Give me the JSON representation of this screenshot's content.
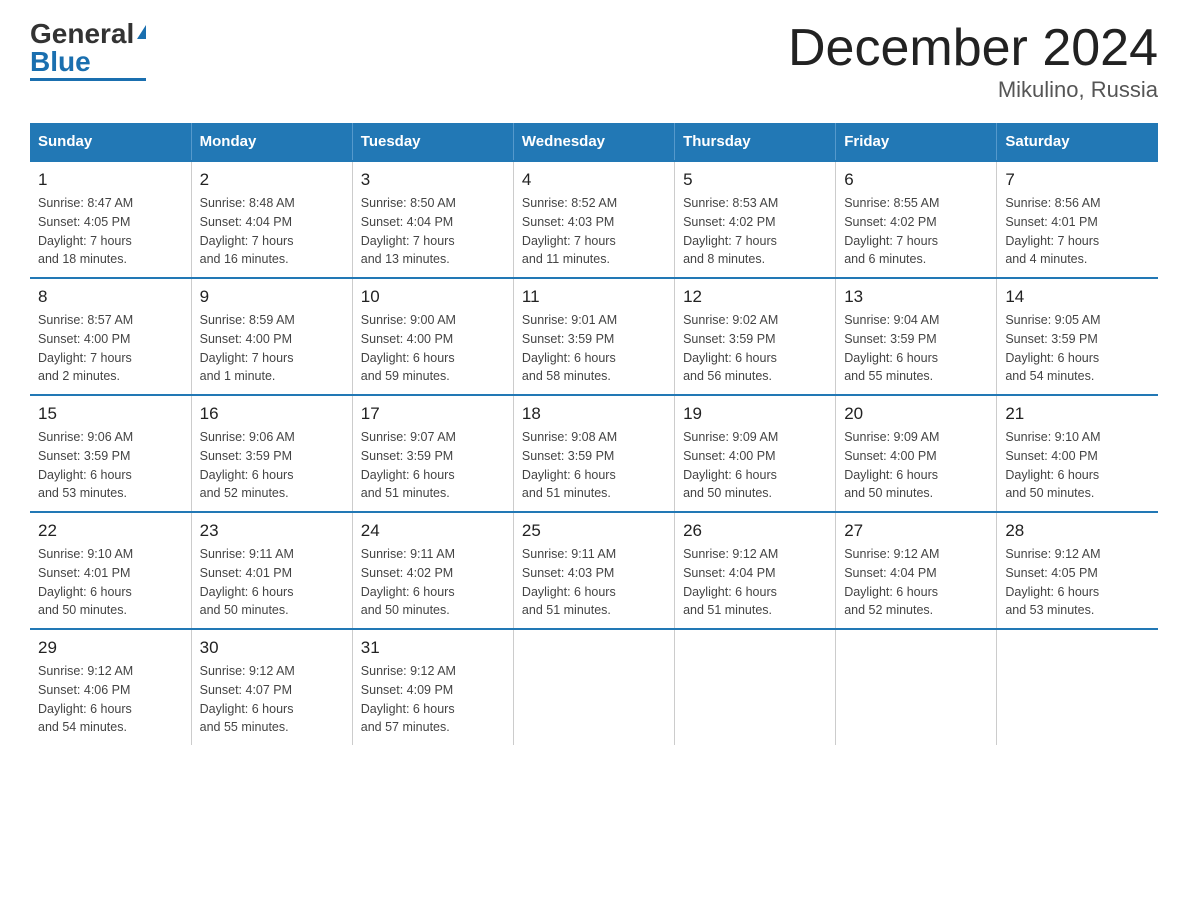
{
  "logo": {
    "general": "General",
    "blue": "Blue"
  },
  "title": "December 2024",
  "location": "Mikulino, Russia",
  "days_of_week": [
    "Sunday",
    "Monday",
    "Tuesday",
    "Wednesday",
    "Thursday",
    "Friday",
    "Saturday"
  ],
  "weeks": [
    [
      {
        "day": "1",
        "info": "Sunrise: 8:47 AM\nSunset: 4:05 PM\nDaylight: 7 hours\nand 18 minutes."
      },
      {
        "day": "2",
        "info": "Sunrise: 8:48 AM\nSunset: 4:04 PM\nDaylight: 7 hours\nand 16 minutes."
      },
      {
        "day": "3",
        "info": "Sunrise: 8:50 AM\nSunset: 4:04 PM\nDaylight: 7 hours\nand 13 minutes."
      },
      {
        "day": "4",
        "info": "Sunrise: 8:52 AM\nSunset: 4:03 PM\nDaylight: 7 hours\nand 11 minutes."
      },
      {
        "day": "5",
        "info": "Sunrise: 8:53 AM\nSunset: 4:02 PM\nDaylight: 7 hours\nand 8 minutes."
      },
      {
        "day": "6",
        "info": "Sunrise: 8:55 AM\nSunset: 4:02 PM\nDaylight: 7 hours\nand 6 minutes."
      },
      {
        "day": "7",
        "info": "Sunrise: 8:56 AM\nSunset: 4:01 PM\nDaylight: 7 hours\nand 4 minutes."
      }
    ],
    [
      {
        "day": "8",
        "info": "Sunrise: 8:57 AM\nSunset: 4:00 PM\nDaylight: 7 hours\nand 2 minutes."
      },
      {
        "day": "9",
        "info": "Sunrise: 8:59 AM\nSunset: 4:00 PM\nDaylight: 7 hours\nand 1 minute."
      },
      {
        "day": "10",
        "info": "Sunrise: 9:00 AM\nSunset: 4:00 PM\nDaylight: 6 hours\nand 59 minutes."
      },
      {
        "day": "11",
        "info": "Sunrise: 9:01 AM\nSunset: 3:59 PM\nDaylight: 6 hours\nand 58 minutes."
      },
      {
        "day": "12",
        "info": "Sunrise: 9:02 AM\nSunset: 3:59 PM\nDaylight: 6 hours\nand 56 minutes."
      },
      {
        "day": "13",
        "info": "Sunrise: 9:04 AM\nSunset: 3:59 PM\nDaylight: 6 hours\nand 55 minutes."
      },
      {
        "day": "14",
        "info": "Sunrise: 9:05 AM\nSunset: 3:59 PM\nDaylight: 6 hours\nand 54 minutes."
      }
    ],
    [
      {
        "day": "15",
        "info": "Sunrise: 9:06 AM\nSunset: 3:59 PM\nDaylight: 6 hours\nand 53 minutes."
      },
      {
        "day": "16",
        "info": "Sunrise: 9:06 AM\nSunset: 3:59 PM\nDaylight: 6 hours\nand 52 minutes."
      },
      {
        "day": "17",
        "info": "Sunrise: 9:07 AM\nSunset: 3:59 PM\nDaylight: 6 hours\nand 51 minutes."
      },
      {
        "day": "18",
        "info": "Sunrise: 9:08 AM\nSunset: 3:59 PM\nDaylight: 6 hours\nand 51 minutes."
      },
      {
        "day": "19",
        "info": "Sunrise: 9:09 AM\nSunset: 4:00 PM\nDaylight: 6 hours\nand 50 minutes."
      },
      {
        "day": "20",
        "info": "Sunrise: 9:09 AM\nSunset: 4:00 PM\nDaylight: 6 hours\nand 50 minutes."
      },
      {
        "day": "21",
        "info": "Sunrise: 9:10 AM\nSunset: 4:00 PM\nDaylight: 6 hours\nand 50 minutes."
      }
    ],
    [
      {
        "day": "22",
        "info": "Sunrise: 9:10 AM\nSunset: 4:01 PM\nDaylight: 6 hours\nand 50 minutes."
      },
      {
        "day": "23",
        "info": "Sunrise: 9:11 AM\nSunset: 4:01 PM\nDaylight: 6 hours\nand 50 minutes."
      },
      {
        "day": "24",
        "info": "Sunrise: 9:11 AM\nSunset: 4:02 PM\nDaylight: 6 hours\nand 50 minutes."
      },
      {
        "day": "25",
        "info": "Sunrise: 9:11 AM\nSunset: 4:03 PM\nDaylight: 6 hours\nand 51 minutes."
      },
      {
        "day": "26",
        "info": "Sunrise: 9:12 AM\nSunset: 4:04 PM\nDaylight: 6 hours\nand 51 minutes."
      },
      {
        "day": "27",
        "info": "Sunrise: 9:12 AM\nSunset: 4:04 PM\nDaylight: 6 hours\nand 52 minutes."
      },
      {
        "day": "28",
        "info": "Sunrise: 9:12 AM\nSunset: 4:05 PM\nDaylight: 6 hours\nand 53 minutes."
      }
    ],
    [
      {
        "day": "29",
        "info": "Sunrise: 9:12 AM\nSunset: 4:06 PM\nDaylight: 6 hours\nand 54 minutes."
      },
      {
        "day": "30",
        "info": "Sunrise: 9:12 AM\nSunset: 4:07 PM\nDaylight: 6 hours\nand 55 minutes."
      },
      {
        "day": "31",
        "info": "Sunrise: 9:12 AM\nSunset: 4:09 PM\nDaylight: 6 hours\nand 57 minutes."
      },
      null,
      null,
      null,
      null
    ]
  ],
  "colors": {
    "header_bg": "#2278b5",
    "header_text": "#ffffff",
    "border": "#2278b5"
  }
}
